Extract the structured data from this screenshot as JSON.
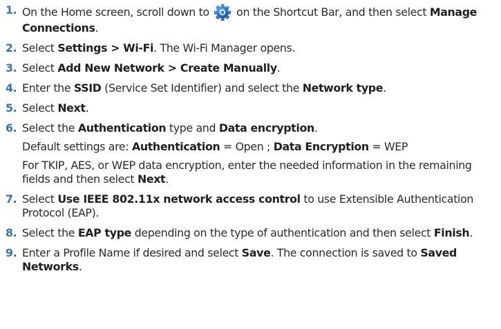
{
  "steps": [
    {
      "number": "1.",
      "before_icon": "On the Home screen, scroll down to ",
      "icon": "settings-gear-icon",
      "after_icon": " on the Shortcut Bar, and then select ",
      "bold_1": "Manage Connections",
      "end": "."
    },
    {
      "number": "2.",
      "t1": "Select ",
      "bold_1": "Settings > Wi-Fi",
      "t2": ". The Wi-Fi Manager opens."
    },
    {
      "number": "3.",
      "t1": "Select ",
      "bold_1": "Add New Network > Create Manually",
      "t2": "."
    },
    {
      "number": "4.",
      "t1": "Enter the ",
      "bold_1": "SSID",
      "t2": " (Service Set Identifier) and select the ",
      "bold_2": "Network type",
      "t3": "."
    },
    {
      "number": "5.",
      "t1": "Select ",
      "bold_1": "Next",
      "t2": "."
    },
    {
      "number": "6.",
      "t1": "Select the ",
      "bold_1": "Authentication",
      "t2": " type and ",
      "bold_2": "Data encryption",
      "t3": ".",
      "note_1": {
        "t1": "Default settings are: ",
        "bold_1": "Authentication",
        "t2": " = Open ; ",
        "bold_2": "Data Encryption",
        "t3": " = WEP"
      },
      "note_2": {
        "t1": "For TKIP, AES, or WEP data encryption, enter the needed information in the remaining fields and then select ",
        "bold_1": "Next",
        "t2": "."
      }
    },
    {
      "number": "7.",
      "t1": "Select ",
      "bold_1": "Use IEEE 802.11x network access control",
      "t2": " to use Extensible Authentication Protocol (EAP)."
    },
    {
      "number": "8.",
      "t1": "Select the ",
      "bold_1": "EAP type",
      "t2": " depending on the type of authentication and then select ",
      "bold_2": "Finish",
      "t3": "."
    },
    {
      "number": "9.",
      "t1": "Enter a Profile Name if desired and select ",
      "bold_1": "Save",
      "t2": ". The connection is saved to ",
      "bold_2": "Saved Networks",
      "t3": "."
    }
  ],
  "colors": {
    "step_number": "#3572b6",
    "text": "#2a2a2a",
    "icon_blue": "#2f78c8"
  }
}
